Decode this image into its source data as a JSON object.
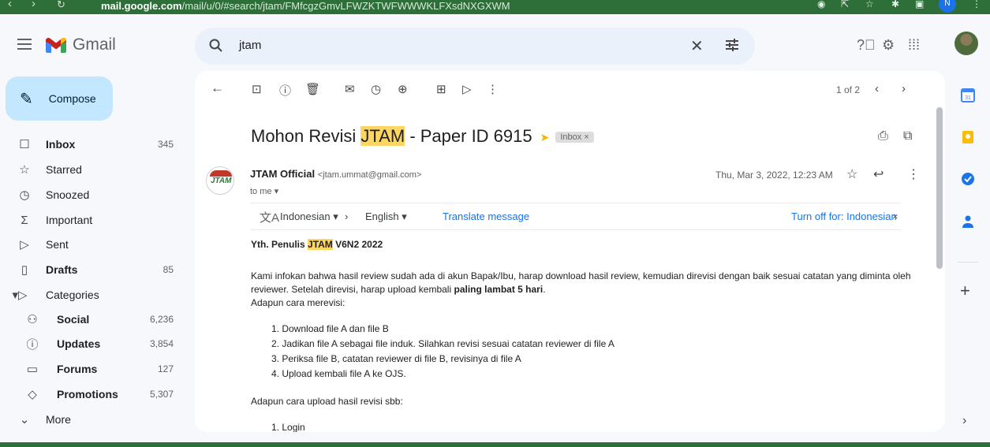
{
  "browser": {
    "url_host": "mail.google.com",
    "url_path": "/mail/u/0/#search/jtam/FMfcgzGmvLFWZKTWFWWWKLFXsdNXGXWM"
  },
  "header": {
    "app_name": "Gmail",
    "search_value": "jtam"
  },
  "sidebar": {
    "compose_label": "Compose",
    "items": [
      {
        "label": "Inbox",
        "count": "345"
      },
      {
        "label": "Starred",
        "count": ""
      },
      {
        "label": "Snoozed",
        "count": ""
      },
      {
        "label": "Important",
        "count": ""
      },
      {
        "label": "Sent",
        "count": ""
      },
      {
        "label": "Drafts",
        "count": "85"
      },
      {
        "label": "Categories",
        "count": ""
      },
      {
        "label": "Social",
        "count": "6,236"
      },
      {
        "label": "Updates",
        "count": "3,854"
      },
      {
        "label": "Forums",
        "count": "127"
      },
      {
        "label": "Promotions",
        "count": "5,307"
      },
      {
        "label": "More",
        "count": ""
      }
    ]
  },
  "toolbar": {
    "pager": "1 of 2"
  },
  "message": {
    "subject_pre": "Mohon Revisi ",
    "subject_hl": "JTAM",
    "subject_post": " - Paper ID 6915",
    "badge": "Inbox ×",
    "sender_name": "JTAM Official",
    "sender_email": "<jtam.ummat@gmail.com>",
    "to": "to me ▾",
    "date": "Thu, Mar 3, 2022, 12:23 AM",
    "avatar_text": "JTAM"
  },
  "translate": {
    "source": "Indonesian ▾",
    "target": "English ▾",
    "link": "Translate message",
    "turn_off": "Turn off for: Indonesian",
    "close": "×"
  },
  "body": {
    "greeting_pre": "Yth. Penulis ",
    "greeting_hl": "JTAM",
    "greeting_post": " V6N2 2022",
    "paragraph_a": "Kami infokan bahwa hasil review sudah ada di akun Bapak/Ibu, harap download hasil review, kemudian direvisi dengan baik sesuai catatan yang diminta oleh reviewer. Setelah direvisi, harap upload kembali ",
    "paragraph_bold": "paling lambat 5 hari",
    "paragraph_end": ".",
    "intro_revise": "Adapun cara merevisi:",
    "steps": [
      "1. Download file A dan file B",
      "2. Jadikan file A sebagai file induk. Silahkan revisi sesuai catatan reviewer di file A",
      "3. Periksa file B, catatan reviewer di file B, revisinya di file A",
      "4. Upload kembali file A ke OJS."
    ],
    "intro_upload": "Adapun cara upload hasil revisi sbb:",
    "upload_steps": [
      "1. Login"
    ]
  },
  "colors": {
    "highlight": "#fcd663",
    "compose_bg": "#c2e7ff",
    "browser_bar": "#2e6e39",
    "link": "#1a73e8"
  }
}
